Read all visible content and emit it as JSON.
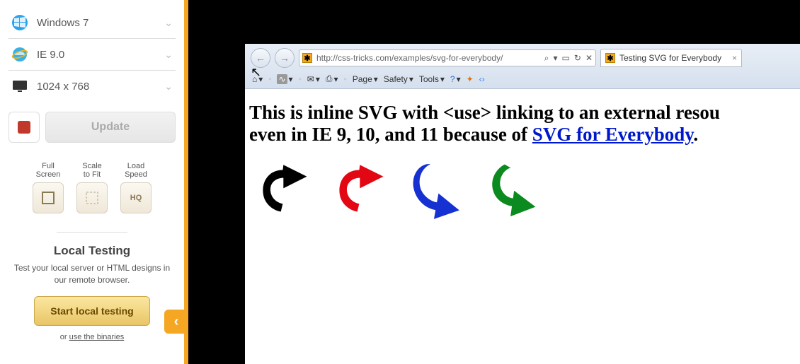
{
  "sidebar": {
    "os": "Windows 7",
    "browser": "IE 9.0",
    "resolution": "1024 x 768",
    "update": "Update",
    "options": {
      "fullscreen_l1": "Full",
      "fullscreen_l2": "Screen",
      "scale_l1": "Scale",
      "scale_l2": "to Fit",
      "speed_l1": "Load",
      "speed_l2": "Speed",
      "hq": "HQ"
    },
    "local_title": "Local Testing",
    "local_sub": "Test your local server or HTML designs in our remote browser.",
    "local_btn": "Start local testing",
    "or_text": "or ",
    "binaries": "use the binaries"
  },
  "ie": {
    "url": "http://css-tricks.com/examples/svg-for-everybody/",
    "tab_title": "Testing SVG for Everybody",
    "menu": {
      "page": "Page",
      "safety": "Safety",
      "tools": "Tools"
    },
    "addr_icons": {
      "search": "⌕",
      "refresh": "↻",
      "stop": "✕"
    }
  },
  "page": {
    "line1a": "This is inline SVG with <use> linking to an external resou",
    "line2a": "even in IE 9, 10, and 11 because of ",
    "link": "SVG for Everybody",
    "period": "."
  }
}
